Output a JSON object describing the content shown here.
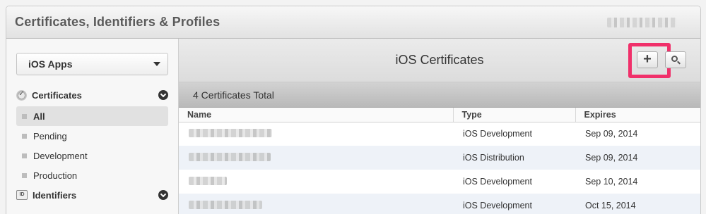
{
  "header": {
    "title": "Certificates, Identifiers & Profiles"
  },
  "sidebar": {
    "platform_select": "iOS Apps",
    "certificates": {
      "label": "Certificates",
      "items": [
        {
          "label": "All",
          "active": true
        },
        {
          "label": "Pending",
          "active": false
        },
        {
          "label": "Development",
          "active": false
        },
        {
          "label": "Production",
          "active": false
        }
      ]
    },
    "identifiers": {
      "label": "Identifiers"
    }
  },
  "main": {
    "title": "iOS Certificates",
    "add_button_label": "+",
    "total_text": "4 Certificates Total",
    "columns": [
      "Name",
      "Type",
      "Expires"
    ],
    "rows": [
      {
        "type": "iOS Development",
        "expires": "Sep 09, 2014"
      },
      {
        "type": "iOS Distribution",
        "expires": "Sep 09, 2014"
      },
      {
        "type": "iOS Development",
        "expires": "Sep 10, 2014"
      },
      {
        "type": "iOS Development",
        "expires": "Oct 15, 2014"
      }
    ]
  },
  "colors": {
    "highlight": "#f0306a",
    "alt_row": "#eef2f8"
  },
  "icons": [
    "certificate-icon",
    "id-icon",
    "chevron-down-icon",
    "plus-icon",
    "search-icon"
  ]
}
